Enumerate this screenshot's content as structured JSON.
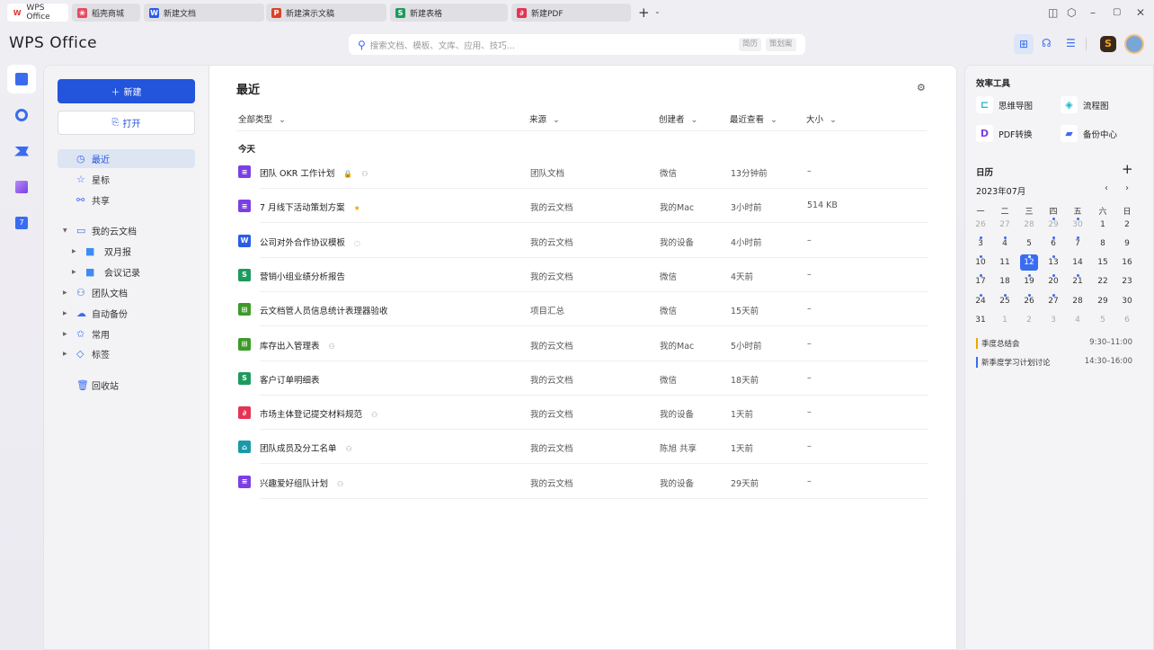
{
  "tabs": [
    {
      "label": "WPS Office",
      "icon": "wps-logo-icon",
      "color": "#e8332f",
      "glyph": "W",
      "active": true
    },
    {
      "label": "稻壳商城",
      "icon": "docer-icon",
      "color": "#e84a5f",
      "glyph": "❀"
    },
    {
      "label": "新建文档",
      "icon": "writer-icon",
      "color": "#2b5ce6",
      "glyph": "W"
    },
    {
      "label": "新建演示文稿",
      "icon": "presentation-icon",
      "color": "#d9432a",
      "glyph": "P"
    },
    {
      "label": "新建表格",
      "icon": "spreadsheet-icon",
      "color": "#1f9a5e",
      "glyph": "S"
    },
    {
      "label": "新建PDF",
      "icon": "pdf-icon",
      "color": "#e33456",
      "glyph": "∂"
    }
  ],
  "app": {
    "logo": "WPS Office"
  },
  "search": {
    "placeholder": "搜索文档、模板、文库、应用、技巧...",
    "chips": [
      "简历",
      "策划案"
    ]
  },
  "sidebar": {
    "new_label": "新建",
    "open_label": "打开",
    "items": [
      {
        "label": "最近",
        "icon": "clock-icon",
        "glyph": "◷",
        "selected": true
      },
      {
        "label": "星标",
        "icon": "star-icon",
        "glyph": "☆"
      },
      {
        "label": "共享",
        "icon": "share-icon",
        "glyph": "⚯"
      },
      {
        "label": "我的云文档",
        "icon": "folder-icon",
        "glyph": "▭",
        "expand": "▼"
      },
      {
        "label": "双月报",
        "icon": "folder-filled-icon",
        "glyph": "■",
        "expand": "▶",
        "indent": true
      },
      {
        "label": "会议记录",
        "icon": "folder-filled-icon",
        "glyph": "■",
        "expand": "▶",
        "indent": true
      },
      {
        "label": "团队文档",
        "icon": "team-icon",
        "glyph": "⚇",
        "expand": "▶"
      },
      {
        "label": "自动备份",
        "icon": "cloud-upload-icon",
        "glyph": "☁",
        "expand": "▶"
      },
      {
        "label": "常用",
        "icon": "pin-icon",
        "glyph": "✩",
        "expand": "▶"
      },
      {
        "label": "标签",
        "icon": "tag-icon",
        "glyph": "◇",
        "expand": "▶"
      },
      {
        "label": "回收站",
        "icon": "trash-icon",
        "glyph": "🗑"
      }
    ]
  },
  "main": {
    "title": "最近",
    "columns": [
      "全部类型",
      "来源",
      "创建者",
      "最近查看",
      "大小"
    ],
    "group": "今天",
    "files": [
      {
        "name": "团队 OKR 工作计划",
        "type": "doc",
        "color": "#7b3fe4",
        "glyph": "≡",
        "badges": [
          "🔒",
          "⚇"
        ],
        "source": "团队文档",
        "creator": "微信",
        "viewed": "13分钟前",
        "size": "–"
      },
      {
        "name": "7 月线下活动策划方案",
        "type": "doc",
        "color": "#7b3fe4",
        "glyph": "≡",
        "badges": [
          "★"
        ],
        "source": "我的云文档",
        "creator": "我的Mac",
        "viewed": "3小时前",
        "size": "514 KB"
      },
      {
        "name": "公司对外合作协议模板",
        "type": "writer",
        "color": "#2b5ce6",
        "glyph": "W",
        "badges": [
          "◌"
        ],
        "source": "我的云文档",
        "creator": "我的设备",
        "viewed": "4小时前",
        "size": "–"
      },
      {
        "name": "营销小组业绩分析报告",
        "type": "sheet",
        "color": "#1f9a5e",
        "glyph": "S",
        "badges": [],
        "source": "我的云文档",
        "creator": "微信",
        "viewed": "4天前",
        "size": "–"
      },
      {
        "name": "云文档管人员信息统计表理器验收",
        "type": "table",
        "color": "#3d9a2a",
        "glyph": "⊞",
        "badges": [],
        "source": "项目汇总",
        "creator": "微信",
        "viewed": "15天前",
        "size": "–"
      },
      {
        "name": "库存出入管理表",
        "type": "table",
        "color": "#3d9a2a",
        "glyph": "⊞",
        "badges": [
          "⚇"
        ],
        "source": "我的云文档",
        "creator": "我的Mac",
        "viewed": "5小时前",
        "size": "–"
      },
      {
        "name": "客户订单明细表",
        "type": "sheet",
        "color": "#1f9a5e",
        "glyph": "S",
        "badges": [],
        "source": "我的云文档",
        "creator": "微信",
        "viewed": "18天前",
        "size": "–"
      },
      {
        "name": "市场主体登记提交材料规范",
        "type": "pdf",
        "color": "#e33456",
        "glyph": "∂",
        "badges": [
          "⚇"
        ],
        "source": "我的云文档",
        "creator": "我的设备",
        "viewed": "1天前",
        "size": "–"
      },
      {
        "name": "团队成员及分工名单",
        "type": "form",
        "color": "#1a9aa8",
        "glyph": "⌂",
        "badges": [
          "⚇"
        ],
        "source": "我的云文档",
        "creator": "陈旭 共享",
        "viewed": "1天前",
        "size": "–"
      },
      {
        "name": "兴趣爱好组队计划",
        "type": "doc",
        "color": "#7b3fe4",
        "glyph": "≡",
        "badges": [
          "⚇"
        ],
        "source": "我的云文档",
        "creator": "我的设备",
        "viewed": "29天前",
        "size": "–"
      }
    ]
  },
  "tools": {
    "title": "效率工具",
    "items": [
      {
        "label": "思维导图",
        "icon": "mindmap-icon",
        "color": "#14b8c8",
        "glyph": "⊏"
      },
      {
        "label": "流程图",
        "icon": "flowchart-icon",
        "color": "#14b8c8",
        "glyph": "◈"
      },
      {
        "label": "PDF转换",
        "icon": "pdf-convert-icon",
        "color": "#7b3fe4",
        "glyph": "D"
      },
      {
        "label": "备份中心",
        "icon": "backup-icon",
        "color": "#3a6cf0",
        "glyph": "▰"
      }
    ]
  },
  "calendar": {
    "title": "日历",
    "month": "2023年07月",
    "weekdays": [
      "一",
      "二",
      "三",
      "四",
      "五",
      "六",
      "日"
    ],
    "weeks": [
      [
        [
          "26",
          1,
          0
        ],
        [
          "27",
          1,
          0
        ],
        [
          "28",
          1,
          0
        ],
        [
          "29",
          1,
          1
        ],
        [
          "30",
          1,
          1
        ],
        [
          "1",
          0,
          0
        ],
        [
          "2",
          0,
          0
        ]
      ],
      [
        [
          "3",
          0,
          1
        ],
        [
          "4",
          0,
          1
        ],
        [
          "5",
          0,
          0
        ],
        [
          "6",
          0,
          1
        ],
        [
          "7",
          0,
          1
        ],
        [
          "8",
          0,
          0
        ],
        [
          "9",
          0,
          0
        ]
      ],
      [
        [
          "10",
          0,
          1
        ],
        [
          "11",
          0,
          0
        ],
        [
          "12",
          0,
          1
        ],
        [
          "13",
          0,
          1
        ],
        [
          "14",
          0,
          0
        ],
        [
          "15",
          0,
          0
        ],
        [
          "16",
          0,
          0
        ]
      ],
      [
        [
          "17",
          0,
          1
        ],
        [
          "18",
          0,
          0
        ],
        [
          "19",
          0,
          1
        ],
        [
          "20",
          0,
          1
        ],
        [
          "21",
          0,
          1
        ],
        [
          "22",
          0,
          0
        ],
        [
          "23",
          0,
          0
        ]
      ],
      [
        [
          "24",
          0,
          1
        ],
        [
          "25",
          0,
          1
        ],
        [
          "26",
          0,
          1
        ],
        [
          "27",
          0,
          1
        ],
        [
          "28",
          0,
          0
        ],
        [
          "29",
          0,
          0
        ],
        [
          "30",
          0,
          0
        ]
      ],
      [
        [
          "31",
          0,
          0
        ],
        [
          "1",
          1,
          0
        ],
        [
          "2",
          1,
          0
        ],
        [
          "3",
          1,
          0
        ],
        [
          "4",
          1,
          0
        ],
        [
          "5",
          1,
          0
        ],
        [
          "6",
          1,
          0
        ]
      ]
    ],
    "today": "12",
    "events": [
      {
        "title": "季度总结会",
        "time": "9:30–11:00",
        "color": "#f0a500"
      },
      {
        "title": "新季度学习计划讨论",
        "time": "14:30–16:00",
        "color": "#3a6cf0"
      }
    ]
  },
  "accent": "#2254dc"
}
